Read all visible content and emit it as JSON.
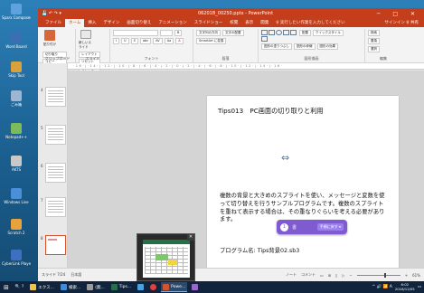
{
  "desktop": {
    "icons": [
      {
        "label": "Sparx Composer",
        "color": "#5ea3e0"
      },
      {
        "label": "Word Board",
        "color": "#3b6fb4"
      },
      {
        "label": "Skip Tool",
        "color": "#d9a13b"
      },
      {
        "label": "ごみ箱",
        "color": "#9bb7d4"
      },
      {
        "label": "Notepad++",
        "color": "#7dbb5a"
      },
      {
        "label": "AKTS",
        "color": "#c9c9c9"
      },
      {
        "label": "Windows Live",
        "color": "#4a90d9"
      },
      {
        "label": "Scratch 2",
        "color": "#e8a23c"
      },
      {
        "label": "CyberLink Player",
        "color": "#3f6fbf"
      }
    ]
  },
  "window": {
    "title": "06201B_00250.pptx - PowerPoint",
    "quick_access": "💾 ↶ ↷ ▾",
    "controls": "─ □ ✕",
    "tabs": [
      "ファイル",
      "ホーム",
      "挿入",
      "デザイン",
      "画面切り替え",
      "アニメーション",
      "スライドショー",
      "校閲",
      "表示",
      "開発"
    ],
    "active_tab": "ホーム",
    "tell_me": "♀ 実行したい作業を入力してください",
    "user": "サインイン  ♀ 共有"
  },
  "ribbon": {
    "groups": [
      {
        "name": "クリップボード",
        "buttons": [
          "貼り付け",
          "切り取り",
          "コピー",
          "書式のコピー"
        ]
      },
      {
        "name": "スライド",
        "buttons": [
          "新しいスライド",
          "レイアウト",
          "リセット",
          "セクション"
        ]
      },
      {
        "name": "フォント",
        "buttons": [
          "B",
          "I",
          "U",
          "S",
          "abc",
          "AV",
          "Aa",
          "A"
        ]
      },
      {
        "name": "段落",
        "buttons": [
          "文字列の方向",
          "文字の配置",
          "SmartArt に変換"
        ]
      },
      {
        "name": "図形描画",
        "buttons": [
          "配置",
          "クイックスタイル",
          "図形の塗りつぶし",
          "図形の枠線",
          "図形の効果"
        ]
      },
      {
        "name": "編集",
        "buttons": [
          "検索",
          "置換",
          "選択"
        ]
      }
    ]
  },
  "ruler_text": "·16·|·14·|·12·|·10·|·8·|·6·|·4·|·2·|·0·|·2·|·4·|·6·|·8·|·10·|·12·|·14·|·16·",
  "thumbnails": [
    {
      "num": "4",
      "selected": false
    },
    {
      "num": "5",
      "selected": false
    },
    {
      "num": "6",
      "selected": false
    },
    {
      "num": "7",
      "selected": false
    },
    {
      "num": "8",
      "selected": true
    }
  ],
  "slide": {
    "title": "Tips013　PC画面の切り取りと利用",
    "resize_icon": "⇔",
    "body": "複数の背景と大きめのスプライトを使い、メッセージと変数を使って切り替えを行うサンプルプログラムです。複数のスプライトを重ねて表示する場合は、その重なりぐらいを考える必要があります。",
    "program": "プログラム名: Tips背景02.sb3"
  },
  "tip": {
    "number": "1",
    "text": "書",
    "button": "手順に戻す ▾"
  },
  "statusbar": {
    "slide_info": "スライド 7/24",
    "language": "日本語",
    "notes": "ノート",
    "comments": "コメント",
    "zoom": "61%"
  },
  "preview": {
    "close": "✕"
  },
  "taskbar": {
    "start": "⊞",
    "items": [
      {
        "label": "🔍 ?",
        "color": "#ffffff",
        "active": false
      },
      {
        "label": "エクス...",
        "color": "#f3c24a",
        "active": false
      },
      {
        "label": "検索...",
        "color": "#3b8ce0",
        "active": false
      },
      {
        "label": "(無...",
        "color": "#9b9b9b",
        "active": false
      },
      {
        "label": "Tips...",
        "color": "#217346",
        "active": false
      },
      {
        "label": "",
        "color": "#4aa3df",
        "active": false
      },
      {
        "label": "",
        "color": "#e04040",
        "active": false
      },
      {
        "label": "Powe...",
        "color": "#d35230",
        "active": true
      },
      {
        "label": "",
        "color": "#9a68c9",
        "active": false
      }
    ],
    "tray": "^ 🔊 📶 A",
    "time": "6:02",
    "date": "2018/12/05"
  }
}
